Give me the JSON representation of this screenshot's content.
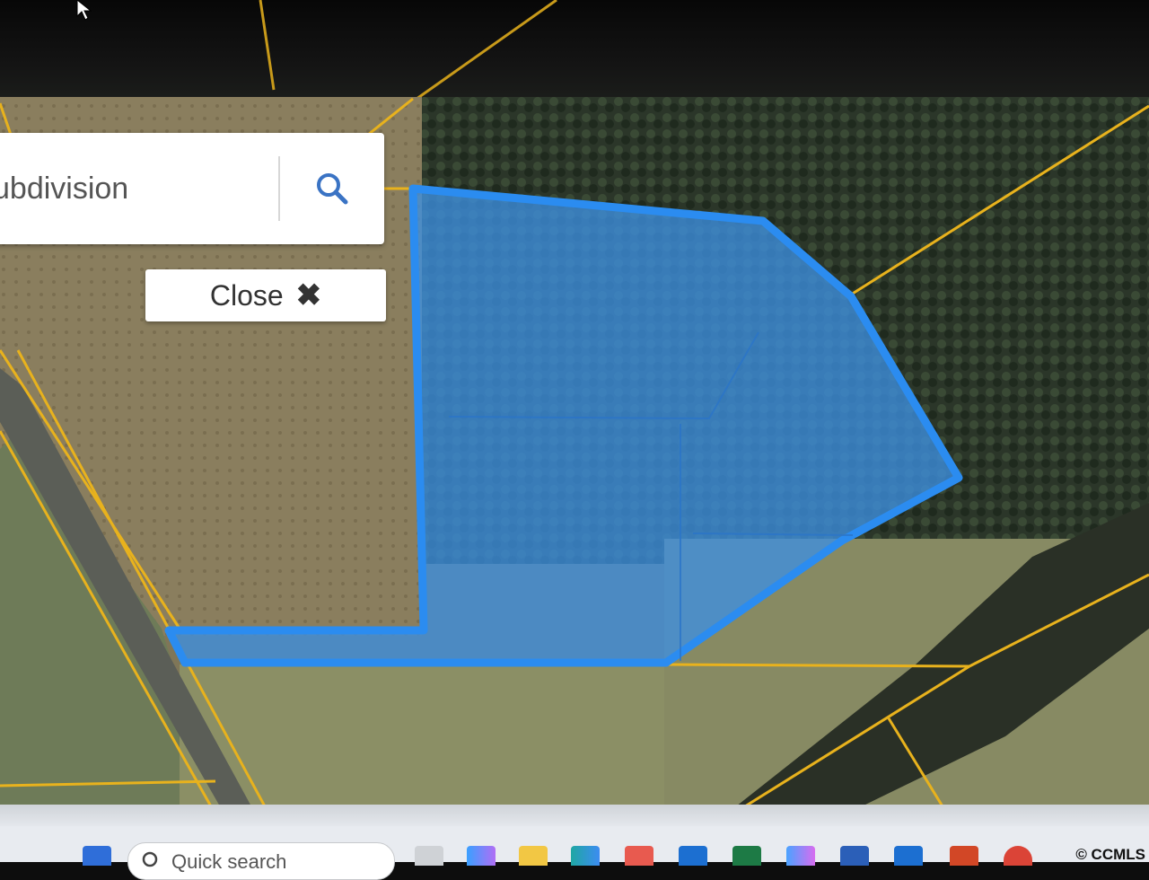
{
  "search": {
    "placeholder": "ubdivision",
    "icon": "search-icon"
  },
  "close_button": {
    "label": "Close",
    "icon": "close-icon",
    "icon_glyph": "✖"
  },
  "taskbar": {
    "search_placeholder": "Quick search",
    "copyright": "© CCMLS",
    "apps": [
      "start-icon",
      "file-icon",
      "copilot-icon",
      "file-explorer-icon",
      "edge-icon",
      "store-icon",
      "outlook-icon",
      "excel-icon",
      "copilot-alt-icon",
      "word-icon",
      "outlook-new-icon",
      "powerpoint-icon",
      "chrome-icon"
    ]
  },
  "colors": {
    "parcel_fill": "#3d8fe0",
    "parcel_outline": "#2b8cf0",
    "parcel_lines": "#e8b21d"
  }
}
